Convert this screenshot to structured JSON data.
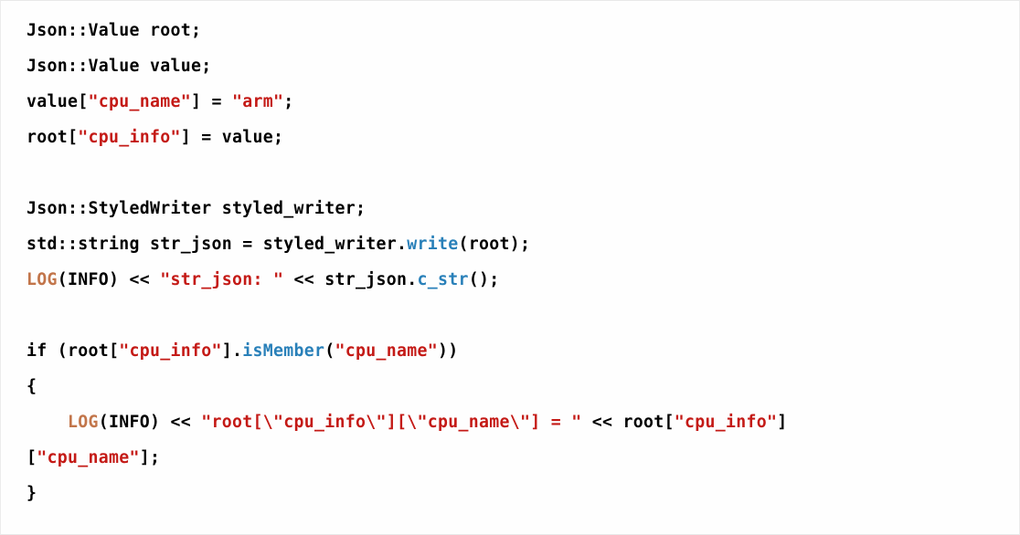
{
  "code": {
    "lines": [
      {
        "indent": 0,
        "tokens": [
          {
            "t": "Json::Value root;",
            "c": "plain"
          }
        ]
      },
      {
        "indent": 0,
        "tokens": [
          {
            "t": "Json::Value value;",
            "c": "plain"
          }
        ]
      },
      {
        "indent": 0,
        "tokens": [
          {
            "t": "value[",
            "c": "plain"
          },
          {
            "t": "\"cpu_name\"",
            "c": "string"
          },
          {
            "t": "] = ",
            "c": "plain"
          },
          {
            "t": "\"arm\"",
            "c": "string"
          },
          {
            "t": ";",
            "c": "plain"
          }
        ]
      },
      {
        "indent": 0,
        "tokens": [
          {
            "t": "root[",
            "c": "plain"
          },
          {
            "t": "\"cpu_info\"",
            "c": "string"
          },
          {
            "t": "] = value;",
            "c": "plain"
          }
        ]
      },
      {
        "indent": 0,
        "tokens": []
      },
      {
        "indent": 0,
        "tokens": [
          {
            "t": "Json::StyledWriter styled_writer;",
            "c": "plain"
          }
        ]
      },
      {
        "indent": 0,
        "tokens": [
          {
            "t": "std::string str_json = styled_writer.",
            "c": "plain"
          },
          {
            "t": "write",
            "c": "func"
          },
          {
            "t": "(root);",
            "c": "plain"
          }
        ]
      },
      {
        "indent": 0,
        "tokens": [
          {
            "t": "LOG",
            "c": "macro"
          },
          {
            "t": "(INFO) << ",
            "c": "plain"
          },
          {
            "t": "\"str_json: \"",
            "c": "string"
          },
          {
            "t": " << str_json.",
            "c": "plain"
          },
          {
            "t": "c_str",
            "c": "func"
          },
          {
            "t": "();",
            "c": "plain"
          }
        ]
      },
      {
        "indent": 0,
        "tokens": []
      },
      {
        "indent": 0,
        "tokens": [
          {
            "t": "if",
            "c": "keyword"
          },
          {
            "t": " (root[",
            "c": "plain"
          },
          {
            "t": "\"cpu_info\"",
            "c": "string"
          },
          {
            "t": "].",
            "c": "plain"
          },
          {
            "t": "isMember",
            "c": "func"
          },
          {
            "t": "(",
            "c": "plain"
          },
          {
            "t": "\"cpu_name\"",
            "c": "string"
          },
          {
            "t": "))",
            "c": "plain"
          }
        ]
      },
      {
        "indent": 0,
        "tokens": [
          {
            "t": "{",
            "c": "plain"
          }
        ]
      },
      {
        "indent": 1,
        "tokens": [
          {
            "t": "LOG",
            "c": "macro"
          },
          {
            "t": "(INFO) << ",
            "c": "plain"
          },
          {
            "t": "\"root[\\\"cpu_info\\\"][\\\"cpu_name\\\"] = \"",
            "c": "string"
          },
          {
            "t": " << root[",
            "c": "plain"
          },
          {
            "t": "\"cpu_info\"",
            "c": "string"
          },
          {
            "t": "]",
            "c": "plain"
          }
        ]
      },
      {
        "indent": 0,
        "tokens": [
          {
            "t": "[",
            "c": "plain"
          },
          {
            "t": "\"cpu_name\"",
            "c": "string"
          },
          {
            "t": "];",
            "c": "plain"
          }
        ]
      },
      {
        "indent": 0,
        "tokens": [
          {
            "t": "}",
            "c": "plain"
          }
        ]
      }
    ]
  }
}
